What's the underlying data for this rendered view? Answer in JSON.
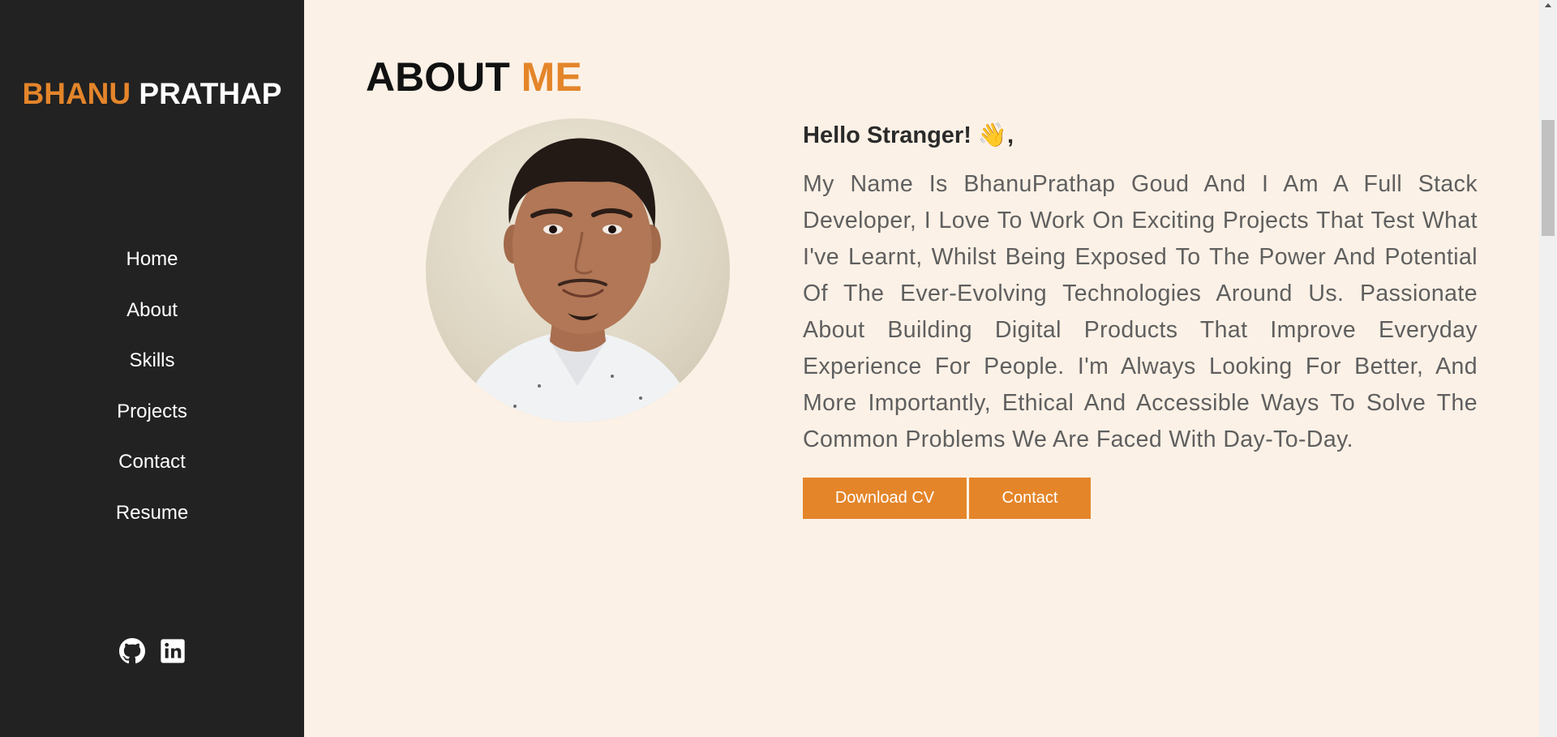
{
  "sidebar": {
    "brand_first": "BHANU",
    "brand_last": "PRATHAP",
    "nav": [
      "Home",
      "About",
      "Skills",
      "Projects",
      "Contact",
      "Resume"
    ],
    "social_icons": [
      "github-icon",
      "linkedin-icon"
    ]
  },
  "about": {
    "title_main": "ABOUT",
    "title_accent": "ME",
    "greeting": "Hello Stranger! 👋,",
    "bio": "My Name Is BhanuPrathap Goud And I Am A Full Stack Developer, I Love To Work On Exciting Projects That Test What I've Learnt, Whilst Being Exposed To The Power And Potential Of The Ever-Evolving Technologies Around Us. Passionate About Building Digital Products That Improve Everyday Experience For People. I'm Always Looking For Better, And More Importantly, Ethical And Accessible Ways To Solve The Common Problems We Are Faced With Day-To-Day.",
    "download_cv_label": "Download CV",
    "contact_label": "Contact"
  },
  "colors": {
    "accent": "#e4852a",
    "sidebar_bg": "#222222",
    "page_bg": "#fcf1e6"
  }
}
